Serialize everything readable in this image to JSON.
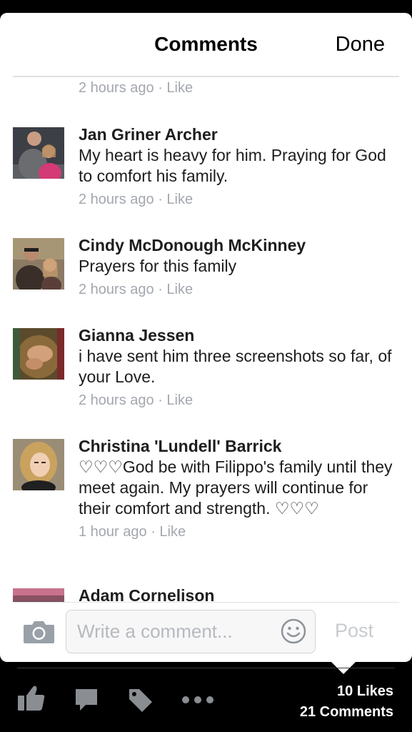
{
  "header": {
    "title": "Comments",
    "done_label": "Done"
  },
  "top_meta": {
    "time": "2 hours ago",
    "separator": " · ",
    "like": "Like"
  },
  "comments": [
    {
      "name": "Jan Griner Archer",
      "text": "My heart is heavy for him. Praying for God to comfort his family.",
      "time": "2 hours ago",
      "like": "Like"
    },
    {
      "name": "Cindy McDonough McKinney",
      "text": "Prayers for this family",
      "time": "2 hours ago",
      "like": "Like"
    },
    {
      "name": "Gianna Jessen",
      "text": "i have sent him three screenshots so far, of your Love.",
      "time": "2 hours ago",
      "like": "Like"
    },
    {
      "name": "Christina 'Lundell' Barrick",
      "text": "♡♡♡God be with Filippo's family until they meet again. My prayers will continue for their comfort and strength. ♡♡♡",
      "time": "1 hour ago",
      "like": "Like"
    },
    {
      "name": "Adam Cornelison",
      "text": "",
      "time": "",
      "like": ""
    }
  ],
  "composer": {
    "placeholder": "Write a comment...",
    "post_label": "Post"
  },
  "toolbar": {
    "likes": "10 Likes",
    "comments": "21 Comments",
    "icons": [
      "like-icon",
      "comment-icon",
      "tag-icon",
      "more-icon",
      "camera-icon",
      "smiley-icon"
    ]
  },
  "colors": {
    "background": "#000000",
    "sheet": "#ffffff",
    "meta_gray": "#a3a7ae",
    "post_disabled": "#c8cbd0"
  }
}
